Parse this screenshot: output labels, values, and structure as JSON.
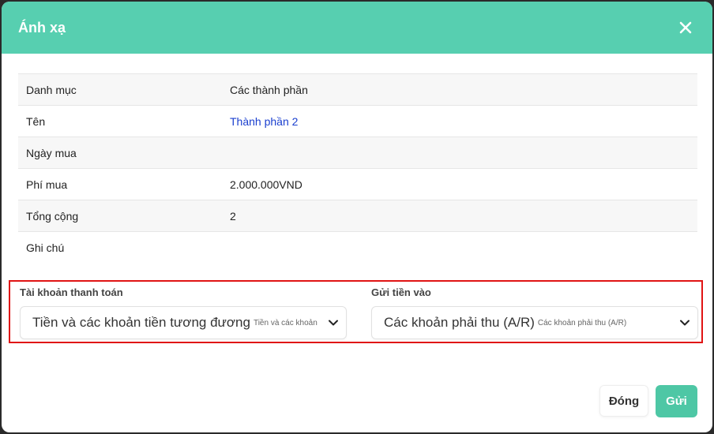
{
  "modal": {
    "title": "Ánh xạ",
    "close_icon": "close-icon",
    "header_color": "#57cfb0"
  },
  "details": {
    "rows": [
      {
        "label": "Danh mục",
        "value": ""
      },
      {
        "label": "Tên",
        "value": ""
      },
      {
        "label": "Ngày mua",
        "value": ""
      },
      {
        "label": "Phí mua",
        "value": ""
      },
      {
        "label": "Tổng cộng",
        "value": ""
      },
      {
        "label": "Ghi chú",
        "value": ""
      }
    ],
    "category": "Các thành phần",
    "name": "Thành phần 2",
    "purchase_date": "",
    "purchase_fee": "2.000.000VND",
    "total": "2",
    "note": ""
  },
  "payment_account": {
    "label": "Tài khoản thanh toán",
    "selected": "Tiền và các khoản tiền tương đương",
    "selected_sub": "Tiền và các khoản"
  },
  "deposit_to": {
    "label": "Gửi tiền vào",
    "selected": "Các khoản phải thu (A/R)",
    "selected_sub": "Các khoản phải thu (A/R)"
  },
  "footer": {
    "close_label": "Đóng",
    "submit_label": "Gửi",
    "submit_color": "#4ec7a5"
  },
  "highlight_color": "#e01414"
}
